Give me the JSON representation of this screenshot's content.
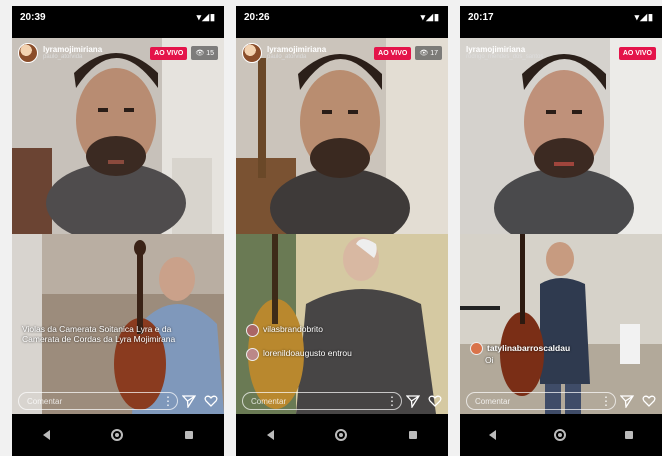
{
  "phones": [
    {
      "time": "20:39",
      "username": "lyramojimiriana",
      "subname": "paulo_atorvida",
      "live_label": "AO VIVO",
      "viewers": "15",
      "comments": [
        {
          "user": "",
          "text": "Violas da Camerata Soitanica Lyra e da Camerata de Cordas da Lyra Mojimirana"
        }
      ],
      "comment_placeholder": "Comentar"
    },
    {
      "time": "20:26",
      "username": "lyramojimiriana",
      "subname": "paulo_atorvida",
      "live_label": "AO VIVO",
      "viewers": "17",
      "comments": [
        {
          "user": "",
          "text": "vilasbrandobrito"
        },
        {
          "user": "",
          "text": "lorenildoaugusto entrou"
        }
      ],
      "comment_placeholder": "Comentar"
    },
    {
      "time": "20:17",
      "username": "lyramojimiriana",
      "subname": "rodrigo_mendes_dos_santos",
      "live_label": "AO VIVO",
      "viewers": "",
      "comments": [
        {
          "user": "tatylinabarroscaldau",
          "text": "Oi"
        }
      ],
      "comment_placeholder": "Comentar"
    }
  ],
  "icons": {
    "share": "paper-plane-icon",
    "like": "heart-icon",
    "more": "more-dots-icon",
    "back": "back-icon",
    "home": "home-icon",
    "recent": "recent-apps-icon"
  },
  "colors": {
    "live_badge": "#e4144a",
    "nav_bar": "#000000"
  }
}
